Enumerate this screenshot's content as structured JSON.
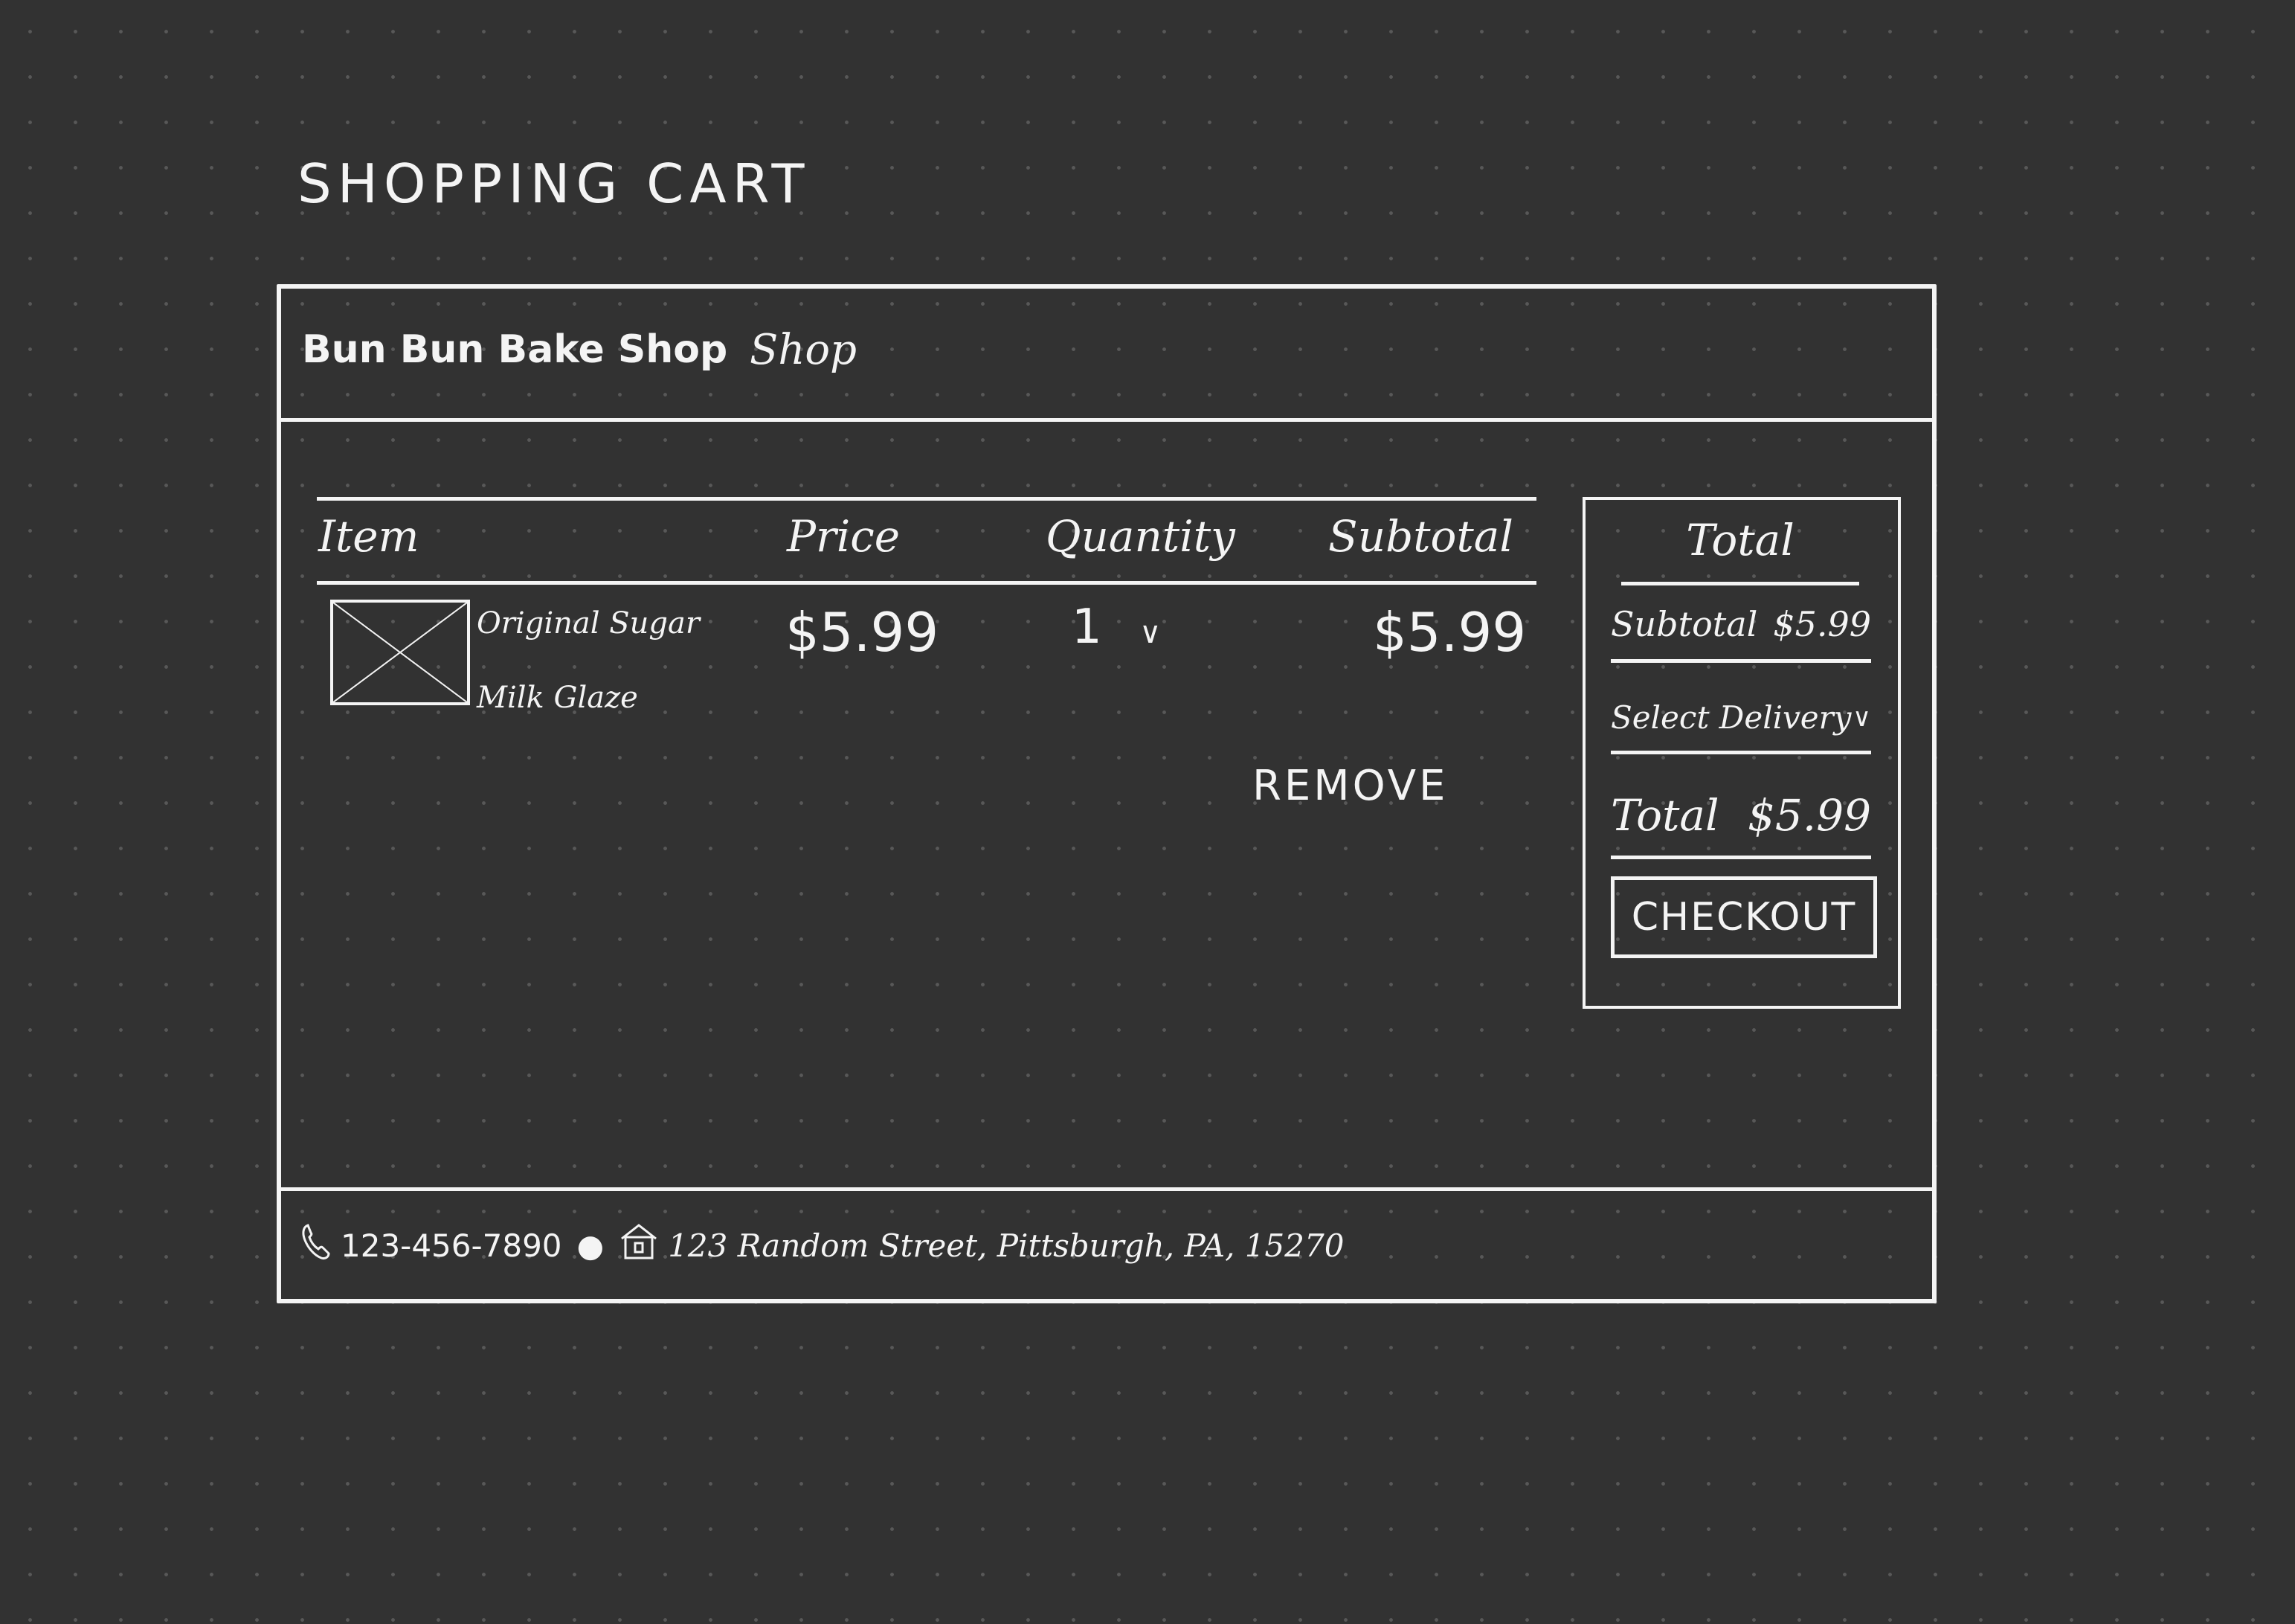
{
  "page": {
    "title": "SHOPPING CART"
  },
  "navbar": {
    "brand": "Bun Bun Bake Shop",
    "shop_link": "Shop"
  },
  "cart": {
    "columns": {
      "item": "Item",
      "price": "Price",
      "quantity": "Quantity",
      "subtotal": "Subtotal"
    },
    "items": [
      {
        "name": "Original Sugar Milk Glaze",
        "price": "$5.99",
        "quantity": "1",
        "subtotal": "$5.99",
        "thumbnail": "image-placeholder"
      }
    ],
    "remove_label": "REMOVE"
  },
  "summary": {
    "title": "Total",
    "subtotal_label": "Subtotal",
    "subtotal_value": "$5.99",
    "delivery_label": "Select Delivery",
    "total_label": "Total",
    "total_value": "$5.99",
    "checkout_label": "CHECKOUT"
  },
  "footer": {
    "phone": "123-456-7890",
    "address": "123 Random Street, Pittsburgh, PA, 15270"
  },
  "icons": {
    "phone": "phone-icon",
    "location": "house-icon",
    "dropdown": "chevron-down-icon"
  },
  "colors": {
    "background": "#323232",
    "ink": "#f4f4f4"
  }
}
